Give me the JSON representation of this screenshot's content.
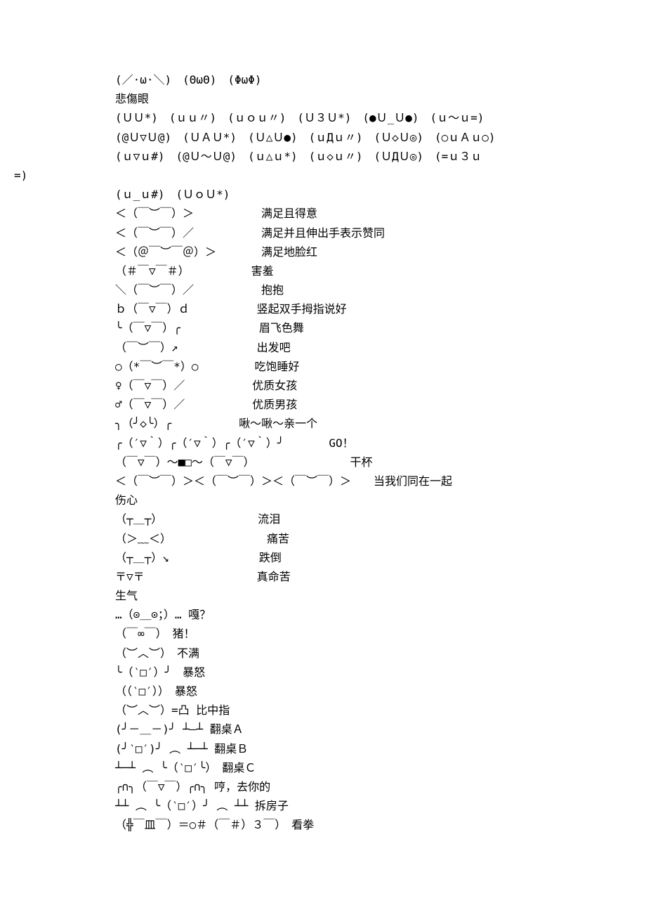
{
  "lines": [
    {
      "indent": "indent1",
      "text": "(／·ω·＼)　(ΘωΘ)　(ΦωΦ)"
    },
    {
      "indent": "indent1",
      "text": "悲傷眼"
    },
    {
      "indent": "indent1",
      "text": ""
    },
    {
      "indent": "indent1",
      "text": "(ＵＵ*)　(ｕｕ〃)　(ｕｏｕ〃)　(Ｕ３Ｕ*)　(●Ｕ_Ｕ●)　(ｕ～ｕ=)"
    },
    {
      "indent": "indent1",
      "text": "(@Ｕ▽Ｕ@)　(ＵＡＵ*)　(Ｕ△Ｕ●)　(ｕДｕ〃)　(Ｕ◇Ｕ◎)　(○ｕＡｕ○)"
    },
    {
      "indent": "indent1",
      "text": "(ｕ▽ｕ#)　(@Ｕ～Ｕ@)　(ｕ△ｕ*)　(ｕ◇ｕ〃)　(ＵДＵ◎)　(=ｕ３ｕ"
    },
    {
      "indent": "indent0",
      "text": "=)"
    },
    {
      "indent": "indent1",
      "text": "(ｕ_ｕ#)　(ＵｏＵ*)"
    },
    {
      "indent": "indent1",
      "text": "＜（￣︶￣）＞　　　　　　满足且得意"
    },
    {
      "indent": "indent1",
      "text": "＜（￣︶￣）／　　　　　　满足并且伸出手表示赞同"
    },
    {
      "indent": "indent1",
      "text": "＜（＠￣︶￣＠）＞　　　　满足地脸红"
    },
    {
      "indent": "indent1",
      "text": "（＃￣▽￣＃）　　　　　　害羞"
    },
    {
      "indent": "indent1",
      "text": "＼（￣︶￣）／　　　　　　抱抱"
    },
    {
      "indent": "indent1",
      "text": "ｂ（￣▽￣）ｄ　　　　　　竖起双手拇指说好"
    },
    {
      "indent": "indent1",
      "text": "╰（￣▽￣）╭　　　　　　　眉飞色舞"
    },
    {
      "indent": "indent1",
      "text": "（￣︶￣）↗　　　　　　　出发吧"
    },
    {
      "indent": "indent1",
      "text": "○（*￣︶￣*）○　　　　　吃饱睡好"
    },
    {
      "indent": "indent1",
      "text": "♀（￣▽￣）／　　　　　　优质女孩"
    },
    {
      "indent": "indent1",
      "text": "♂（￣▽￣）／　　　　　　优质男孩"
    },
    {
      "indent": "indent1",
      "text": "╮（╯◇╰）╭　　　　　　啾～啾～亲一个"
    },
    {
      "indent": "indent1",
      "text": "╭（′▽｀）╭（′▽｀）╭（′▽｀）╯　　　　GO！"
    },
    {
      "indent": "indent1",
      "text": "（￣▽￣）～■□～（￣▽￣）　　　　　　　　　干杯"
    },
    {
      "indent": "indent1",
      "text": "＜（￣︶￣）＞＜（￣︶￣）＞＜（￣︶￣）＞　　当我们同在一起"
    },
    {
      "indent": "indent1",
      "text": ""
    },
    {
      "indent": "indent1",
      "text": "伤心"
    },
    {
      "indent": "indent1",
      "text": ""
    },
    {
      "indent": "indent1",
      "text": "（┬＿┬）　　　　　　　　　流泪"
    },
    {
      "indent": "indent1",
      "text": "（＞﹏＜）　　　　　　　　　痛苦"
    },
    {
      "indent": "indent1",
      "text": "（┬＿┬）↘　　　　　　　　跌倒"
    },
    {
      "indent": "indent1",
      "text": "〒▽〒　　　　　　　　　　真命苦"
    },
    {
      "indent": "indent1",
      "text": "生气"
    },
    {
      "indent": "indent1",
      "text": ""
    },
    {
      "indent": "indent1",
      "text": "…（⊙＿⊙；）… 嘎？"
    },
    {
      "indent": "indent1",
      "text": "（￣∞￣）　猪！"
    },
    {
      "indent": "indent1",
      "text": "（︶︿︶）　不满"
    },
    {
      "indent": "indent1",
      "text": "╰（‵□′）╯　暴怒"
    },
    {
      "indent": "indent1",
      "text": "（（‵□′））　暴怒"
    },
    {
      "indent": "indent1",
      "text": "（︶︿︶）=凸 比中指"
    },
    {
      "indent": "indent1",
      "text": "(╯－＿－)╯ ┴—┴ 翻桌Ａ"
    },
    {
      "indent": "indent1",
      "text": "(╯‵□′)╯ ︵ ┴─┴ 翻桌Ｂ"
    },
    {
      "indent": "indent1",
      "text": "┴─┴ ︵ ╰（‵□′╰）　翻桌Ｃ"
    },
    {
      "indent": "indent1",
      "text": "╭∩╮（￣▽￣）╭∩╮ 哼，去你的"
    },
    {
      "indent": "indent1",
      "text": "┴┴ ︵ ╰（‵□′）╯ ︵ ┴┴ 拆房子"
    },
    {
      "indent": "indent1",
      "text": "（╬￣皿￣）＝○＃（￣＃）３￣）　看拳"
    }
  ]
}
